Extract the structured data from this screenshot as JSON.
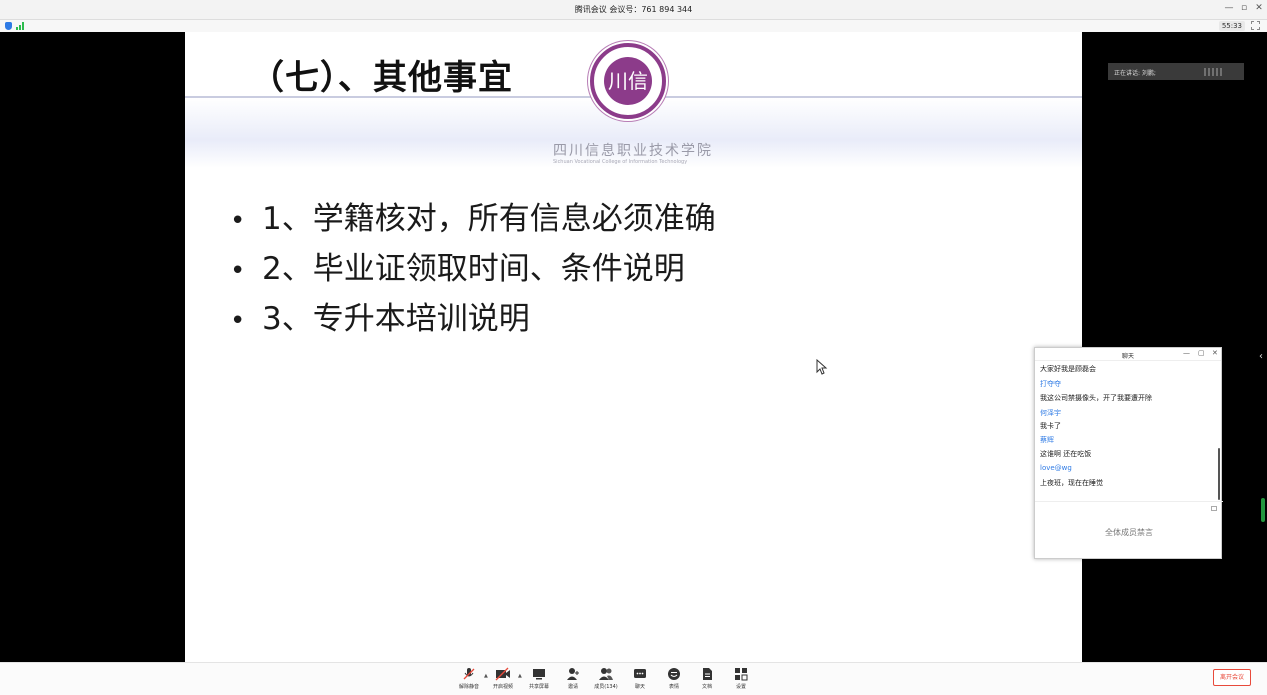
{
  "window": {
    "title": "腾讯会议 会议号：761 894 344",
    "controls": {
      "minimize": "—",
      "maximize": "▫",
      "close": "✕"
    }
  },
  "status": {
    "timer": "55:33",
    "security_icon": "shield-icon",
    "signal_icon": "signal-icon",
    "fullscreen_icon": "fullscreen-icon"
  },
  "slide": {
    "title": "（七）、其他事宜",
    "logo_text": "川信",
    "school_name": "四川信息职业技术学院",
    "school_name_en": "Sichuan Vocational College of Information Technology",
    "bullets": [
      "1、学籍核对，所有信息必须准确",
      "2、毕业证领取时间、条件说明",
      "3、专升本培训说明"
    ],
    "bullet_marker": "•"
  },
  "speaker": {
    "label": "正在讲话: 刘鹏;"
  },
  "chat": {
    "title": "聊天",
    "controls": {
      "minimize": "—",
      "maximize": "▢",
      "close": "✕"
    },
    "messages": [
      {
        "type": "text",
        "value": "大家好我是顾磊会"
      },
      {
        "type": "name",
        "value": "打夺夺"
      },
      {
        "type": "text",
        "value": "我这公司禁摄像头，开了我要遭开除"
      },
      {
        "type": "name",
        "value": "何泽宇"
      },
      {
        "type": "text",
        "value": "我卡了"
      },
      {
        "type": "name",
        "value": "蔡辉"
      },
      {
        "type": "text",
        "value": "这谁啊 还在吃饭"
      },
      {
        "type": "name",
        "value": "love@wg"
      },
      {
        "type": "text",
        "value": "上夜班，现在在睡觉"
      }
    ],
    "mute_notice": "全体成员禁言"
  },
  "toolbar": {
    "items": [
      {
        "id": "unmute",
        "label": "解除静音",
        "icon": "microphone-off-icon",
        "glyph": "🎙"
      },
      {
        "id": "video",
        "label": "开启视频",
        "icon": "camera-off-icon",
        "glyph": "▶"
      },
      {
        "id": "share",
        "label": "共享屏幕",
        "icon": "screen-share-icon",
        "glyph": "▭"
      },
      {
        "id": "invite",
        "label": "邀请",
        "icon": "add-user-icon",
        "glyph": "👤"
      },
      {
        "id": "members",
        "label": "成员(134)",
        "icon": "members-icon",
        "glyph": "👥"
      },
      {
        "id": "chat",
        "label": "聊天",
        "icon": "chat-icon",
        "glyph": "💬"
      },
      {
        "id": "emoji",
        "label": "表情",
        "icon": "emoji-icon",
        "glyph": "☺"
      },
      {
        "id": "docs",
        "label": "文档",
        "icon": "document-icon",
        "glyph": "▤"
      },
      {
        "id": "settings",
        "label": "设置",
        "icon": "settings-icon",
        "glyph": "▦"
      }
    ],
    "leave_label": "离开会议"
  },
  "colors": {
    "accent_blue": "#2f7be5",
    "leave_red": "#e84a3b",
    "logo_purple": "#8c3b8a",
    "signal_green": "#2dbb4e"
  }
}
